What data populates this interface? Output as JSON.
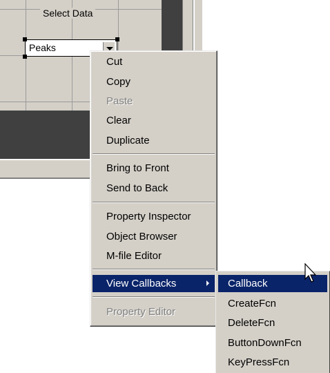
{
  "layout_panel": {
    "title": "Select Data",
    "popup_value": "Peaks"
  },
  "context_menu": {
    "items": [
      {
        "label": "Cut",
        "enabled": true
      },
      {
        "label": "Copy",
        "enabled": true
      },
      {
        "label": "Paste",
        "enabled": false
      },
      {
        "label": "Clear",
        "enabled": true
      },
      {
        "label": "Duplicate",
        "enabled": true
      },
      {
        "label": "Bring to Front",
        "enabled": true
      },
      {
        "label": "Send to Back",
        "enabled": true
      },
      {
        "label": "Property Inspector",
        "enabled": true
      },
      {
        "label": "Object Browser",
        "enabled": true
      },
      {
        "label": "M-file Editor",
        "enabled": true
      },
      {
        "label": "View Callbacks",
        "enabled": true,
        "highlighted": true
      },
      {
        "label": "Property Editor",
        "enabled": false
      }
    ]
  },
  "submenu": {
    "items": [
      {
        "label": "Callback",
        "highlighted": true
      },
      {
        "label": "CreateFcn"
      },
      {
        "label": "DeleteFcn"
      },
      {
        "label": "ButtonDownFcn"
      },
      {
        "label": "KeyPressFcn"
      }
    ]
  },
  "colors": {
    "menu_bg": "#d4d0c8",
    "highlight": "#0a246a",
    "disabled_text": "#808080"
  },
  "icons": {
    "submenu_arrow": "chevron-right-icon",
    "cursor": "arrow-cursor-icon"
  }
}
